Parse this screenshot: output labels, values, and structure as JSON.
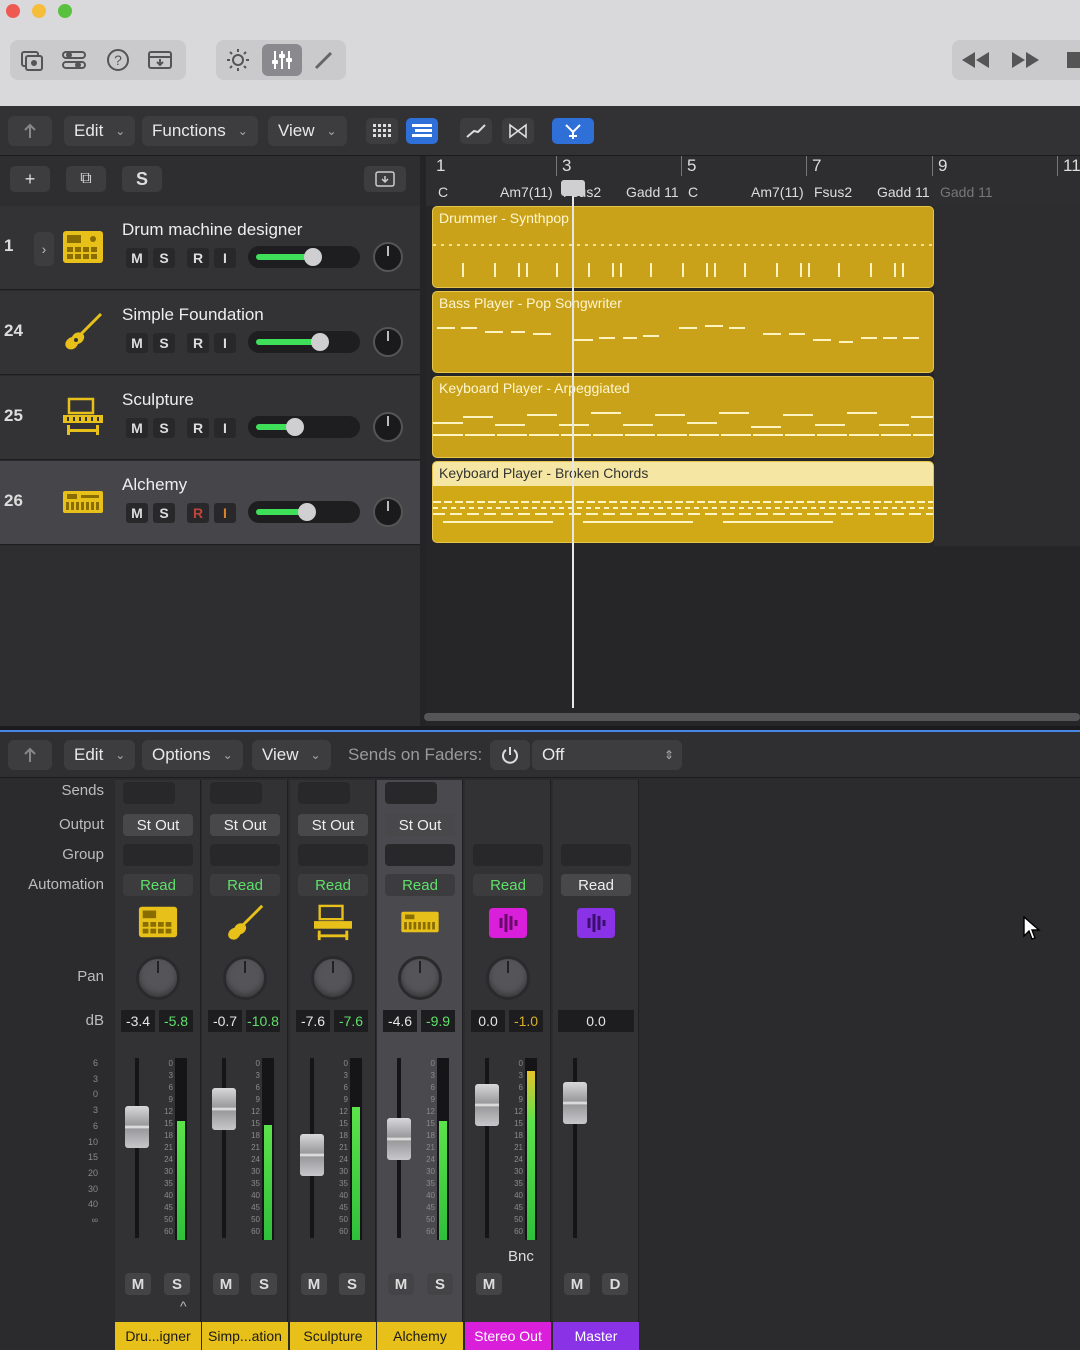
{
  "colors": {
    "region": "#c9a21a",
    "meter": "#3ee05a",
    "read": "#5fe06a",
    "accent_blue": "#2f6fd8",
    "instrument_strip": "#e8c01a",
    "stereo_out_strip": "#d91fd9",
    "master_strip": "#8a33e6"
  },
  "control_bar": {
    "left_icons": [
      "library-icon",
      "inspector-icon",
      "quick-help-icon",
      "import-icon"
    ],
    "mid_icons": [
      "brightness-icon",
      "mixer-icon",
      "pencil-icon"
    ],
    "transport_icons": [
      "rewind-icon",
      "fast-forward-icon",
      "stop-icon"
    ]
  },
  "tracks_toolbar": {
    "edit": "Edit",
    "functions": "Functions",
    "view": "View",
    "icons": [
      "grid-icon",
      "list-icon",
      "automation-curve-icon",
      "flex-icon",
      "catch-icon"
    ]
  },
  "track_header": {
    "add": "+",
    "duplicate": "⧉",
    "solo": "S"
  },
  "tracks": [
    {
      "number": "1",
      "name": "Drum machine designer",
      "icon": "drum-machine-icon",
      "btn_m": "M",
      "btn_s": "S",
      "btn_r": "R",
      "btn_i": "I",
      "volume_fraction": 0.6
    },
    {
      "number": "24",
      "name": "Simple Foundation",
      "icon": "guitar-icon",
      "btn_m": "M",
      "btn_s": "S",
      "btn_r": "R",
      "btn_i": "I",
      "volume_fraction": 0.68
    },
    {
      "number": "25",
      "name": "Sculpture",
      "icon": "synth-icon",
      "btn_m": "M",
      "btn_s": "S",
      "btn_r": "R",
      "btn_i": "I",
      "volume_fraction": 0.42
    },
    {
      "number": "26",
      "name": "Alchemy",
      "icon": "keyboard-icon",
      "btn_m": "M",
      "btn_s": "S",
      "btn_r": "R",
      "btn_i": "I",
      "volume_fraction": 0.54
    }
  ],
  "ruler": {
    "bars": [
      "1",
      "3",
      "5",
      "7",
      "9",
      "11"
    ],
    "chords": [
      "C",
      "Am7(11)",
      "Fsus2",
      "Gadd 11",
      "C",
      "Am7(11)",
      "Fsus2",
      "Gadd 11",
      "Gadd 11"
    ]
  },
  "regions": [
    {
      "name": "Drummer - Synthpop"
    },
    {
      "name": "Bass Player - Pop Songwriter"
    },
    {
      "name": "Keyboard Player - Arpeggiated"
    },
    {
      "name": "Keyboard Player - Broken Chords"
    }
  ],
  "mixer_toolbar": {
    "edit": "Edit",
    "options": "Options",
    "view": "View",
    "sends_on_faders_label": "Sends on Faders:",
    "sends_value": "Off"
  },
  "mixer_labels": {
    "sends": "Sends",
    "output": "Output",
    "group": "Group",
    "automation": "Automation",
    "pan": "Pan",
    "db": "dB"
  },
  "fader_scale": [
    "6",
    "3",
    "0",
    "3",
    "6",
    "10",
    "15",
    "20",
    "30",
    "40",
    "∞"
  ],
  "meter_scale": [
    "0",
    "3",
    "6",
    "9",
    "12",
    "15",
    "18",
    "21",
    "24",
    "30",
    "35",
    "40",
    "45",
    "50",
    "60"
  ],
  "strips": [
    {
      "name": "Dru...igner",
      "output": "St Out",
      "automation": "Read",
      "db_left": "-3.4",
      "db_right": "-5.8",
      "btn_m": "M",
      "btn_s": "S",
      "icon": "drum-machine-icon",
      "meter_level": 0.66
    },
    {
      "name": "Simp...ation",
      "output": "St Out",
      "automation": "Read",
      "db_left": "-0.7",
      "db_right": "-10.8",
      "btn_m": "M",
      "btn_s": "S",
      "icon": "guitar-icon",
      "meter_level": 0.64
    },
    {
      "name": "Sculpture",
      "output": "St Out",
      "automation": "Read",
      "db_left": "-7.6",
      "db_right": "-7.6",
      "btn_m": "M",
      "btn_s": "S",
      "icon": "synth-icon",
      "meter_level": 0.74
    },
    {
      "name": "Alchemy",
      "output": "St Out",
      "automation": "Read",
      "db_left": "-4.6",
      "db_right": "-9.9",
      "btn_m": "M",
      "btn_s": "S",
      "icon": "keyboard-icon",
      "meter_level": 0.66
    },
    {
      "name": "Stereo Out",
      "automation": "Read",
      "db_left": "0.0",
      "db_right": "-1.0",
      "btn_m": "M",
      "bnc": "Bnc",
      "icon": "stereo-out-icon",
      "meter_level": 0.94
    },
    {
      "name": "Master",
      "automation": "Read",
      "db_value": "0.0",
      "btn_m": "M",
      "btn_d": "D",
      "icon": "master-icon"
    }
  ]
}
